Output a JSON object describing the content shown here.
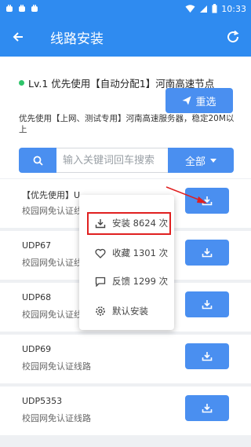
{
  "status": {
    "time": "10:33"
  },
  "header": {
    "title": "线路安装"
  },
  "node": {
    "text": "Lv.1 优先使用【自动分配1】河南高速节点"
  },
  "reselect_label": "重选",
  "description": "优先使用【上网、测试专用】河南高速服务器，稳定20M以上",
  "search": {
    "placeholder": "输入关键词回车搜索"
  },
  "filter_label": "全部",
  "items": [
    {
      "name": "【优先使用】U",
      "sub": "校园网免认证线路"
    },
    {
      "name": "UDP67",
      "sub": "校园网免认证线路"
    },
    {
      "name": "UDP68",
      "sub": "校园网免认证线路"
    },
    {
      "name": "UDP69",
      "sub": "校园网免认证线路"
    },
    {
      "name": "UDP5353",
      "sub": "校园网免认证线路"
    }
  ],
  "menu": [
    {
      "label": "安装 8624 次",
      "icon": "install-icon"
    },
    {
      "label": "收藏 1301 次",
      "icon": "heart-icon"
    },
    {
      "label": "反馈 1299 次",
      "icon": "feedback-icon"
    },
    {
      "label": "默认安装",
      "icon": "gear-icon"
    }
  ],
  "colors": {
    "primary": "#2f8bf0",
    "button": "#4a8ff0",
    "highlight": "#e02020",
    "online": "#2fc46a"
  }
}
